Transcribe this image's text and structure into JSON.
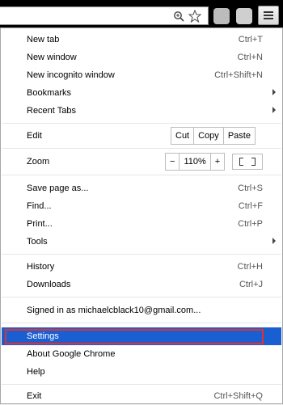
{
  "browser": {
    "zoom_icon": "magnifier-icon",
    "star_icon": "star-icon",
    "menu_button_icon": "hamburger-icon"
  },
  "menu": {
    "items": [
      {
        "label": "New tab",
        "shortcut": "Ctrl+T"
      },
      {
        "label": "New window",
        "shortcut": "Ctrl+N"
      },
      {
        "label": "New incognito window",
        "shortcut": "Ctrl+Shift+N"
      },
      {
        "label": "Bookmarks",
        "submenu": true
      },
      {
        "label": "Recent Tabs",
        "submenu": true
      }
    ],
    "edit": {
      "label": "Edit",
      "cut": "Cut",
      "copy": "Copy",
      "paste": "Paste"
    },
    "zoom": {
      "label": "Zoom",
      "minus": "−",
      "value": "110%",
      "plus": "+"
    },
    "page_items": [
      {
        "label": "Save page as...",
        "shortcut": "Ctrl+S"
      },
      {
        "label": "Find...",
        "shortcut": "Ctrl+F"
      },
      {
        "label": "Print...",
        "shortcut": "Ctrl+P"
      },
      {
        "label": "Tools",
        "submenu": true
      }
    ],
    "history_items": [
      {
        "label": "History",
        "shortcut": "Ctrl+H"
      },
      {
        "label": "Downloads",
        "shortcut": "Ctrl+J"
      }
    ],
    "signed_in": "Signed in as michaelcblack10@gmail.com...",
    "help_items": [
      {
        "label": "Settings"
      },
      {
        "label": "About Google Chrome"
      },
      {
        "label": "Help"
      }
    ],
    "exit": {
      "label": "Exit",
      "shortcut": "Ctrl+Shift+Q"
    }
  },
  "colors": {
    "highlight": "#1a5fd1",
    "annotation_box": "#e0312f"
  }
}
